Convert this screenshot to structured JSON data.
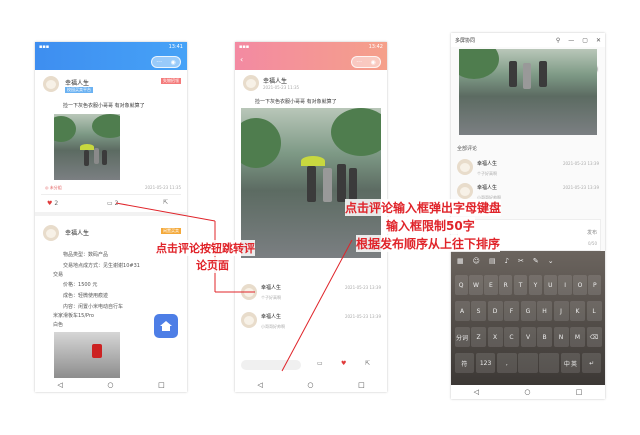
{
  "annotations": {
    "left": [
      "点击评论按钮跳转评",
      "论页面"
    ],
    "right": [
      "点击评论输入框弹出字母键盘",
      "输入框限制50字",
      "根据发布顺序从上往下排序"
    ]
  },
  "phone1": {
    "status_time": "13:41",
    "post": {
      "user": "幸福人生",
      "tag": "校园买卖平台",
      "badge": "失物招领",
      "text": "捡一下灰色衣服小哥哥 有对象就算了",
      "time": "2021-05-23 11:35",
      "location": "未分组",
      "likes": "2",
      "comments": "2"
    },
    "post2": {
      "user": "幸福人生",
      "badge": "闲置买卖",
      "type_label": "物品类型：",
      "type_value": "数码产品",
      "trade_label": "交易地点成方式：",
      "trade_value": "见生谢谢10#31",
      "trade_extra": "交易",
      "price_label": "价格：",
      "price_value": "1500 元",
      "cond_label": "成色：",
      "cond_value": "轻微使用痕迹",
      "content_label": "内容：",
      "content_value": "闲置小米电动自行车",
      "brand": "米家滑板车15/Pro",
      "color": "白色"
    }
  },
  "phone2": {
    "status_time": "13:42",
    "user": "幸福人生",
    "time": "2021-05-23 11:35",
    "text": "捡一下灰色衣服小哥哥 有对象就算了",
    "comments": [
      {
        "user": "幸福人生",
        "text": "个子好高啊",
        "time": "2021-05-23 13:39"
      },
      {
        "user": "幸福人生",
        "text": "小哥哥好帅啊",
        "time": "2021-05-23 13:39"
      }
    ]
  },
  "phone3": {
    "title": "多屏协同",
    "section": "全部评论",
    "comments": [
      {
        "user": "幸福人生",
        "text": "个子好高啊",
        "time": "2021-05-23 13:39"
      },
      {
        "user": "幸福人生",
        "text": "小哥哥好帅啊",
        "time": "2021-05-23 13:39"
      }
    ],
    "publish": "发布",
    "counter": "0/50",
    "keyboard_rows": [
      [
        "Q",
        "W",
        "E",
        "R",
        "T",
        "Y",
        "U",
        "I",
        "O",
        "P"
      ],
      [
        "A",
        "S",
        "D",
        "F",
        "G",
        "H",
        "J",
        "K",
        "L"
      ],
      [
        "分词",
        "Z",
        "X",
        "C",
        "V",
        "B",
        "N",
        "M",
        "⌫"
      ],
      [
        "符",
        "123",
        ",",
        "",
        "",
        "中 英",
        "↵"
      ]
    ]
  }
}
